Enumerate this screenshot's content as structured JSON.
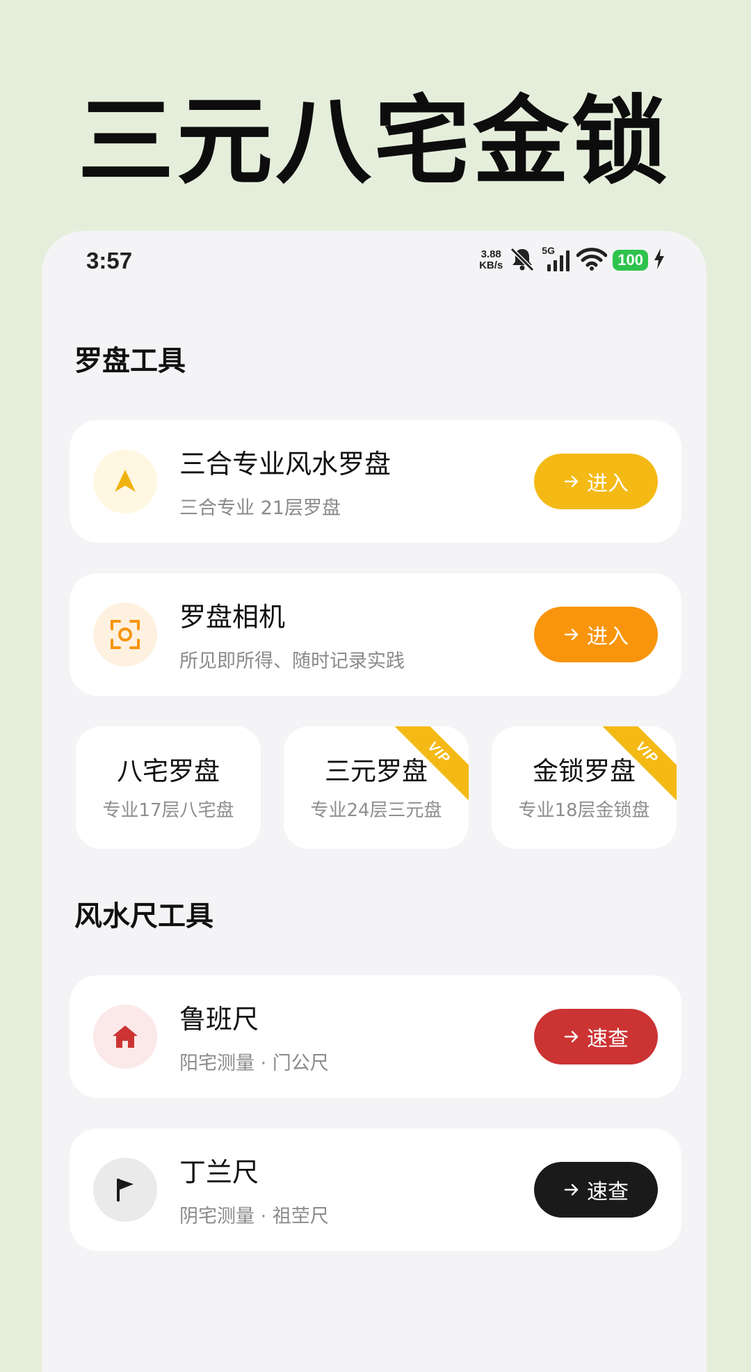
{
  "app_title": "三元八宅金锁",
  "status": {
    "time": "3:57",
    "net_speed_value": "3.88",
    "net_speed_unit": "KB/s",
    "signal_label": "5G",
    "battery": "100"
  },
  "sections": {
    "compass": "罗盘工具",
    "ruler": "风水尺工具"
  },
  "cards": [
    {
      "title": "三合专业风水罗盘",
      "subtitle": "三合专业 21层罗盘",
      "action": "进入",
      "icon": "navigation-arrow-icon",
      "color": "#f4b914"
    },
    {
      "title": "罗盘相机",
      "subtitle": "所见即所得、随时记录实践",
      "action": "进入",
      "icon": "camera-focus-icon",
      "color": "#f8950c"
    }
  ],
  "small_cards": [
    {
      "title": "八宅罗盘",
      "subtitle": "专业17层八宅盘",
      "vip": false
    },
    {
      "title": "三元罗盘",
      "subtitle": "专业24层三元盘",
      "vip": true,
      "badge": "VIP"
    },
    {
      "title": "金锁罗盘",
      "subtitle": "专业18层金锁盘",
      "vip": true,
      "badge": "VIP"
    }
  ],
  "ruler_cards": [
    {
      "title": "鲁班尺",
      "subtitle": "阳宅测量 · 门公尺",
      "action": "速查",
      "icon": "house-icon",
      "color": "#cc3333"
    },
    {
      "title": "丁兰尺",
      "subtitle": "阴宅测量 · 祖茔尺",
      "action": "速查",
      "icon": "flag-icon",
      "color": "#1a1a1a"
    }
  ]
}
